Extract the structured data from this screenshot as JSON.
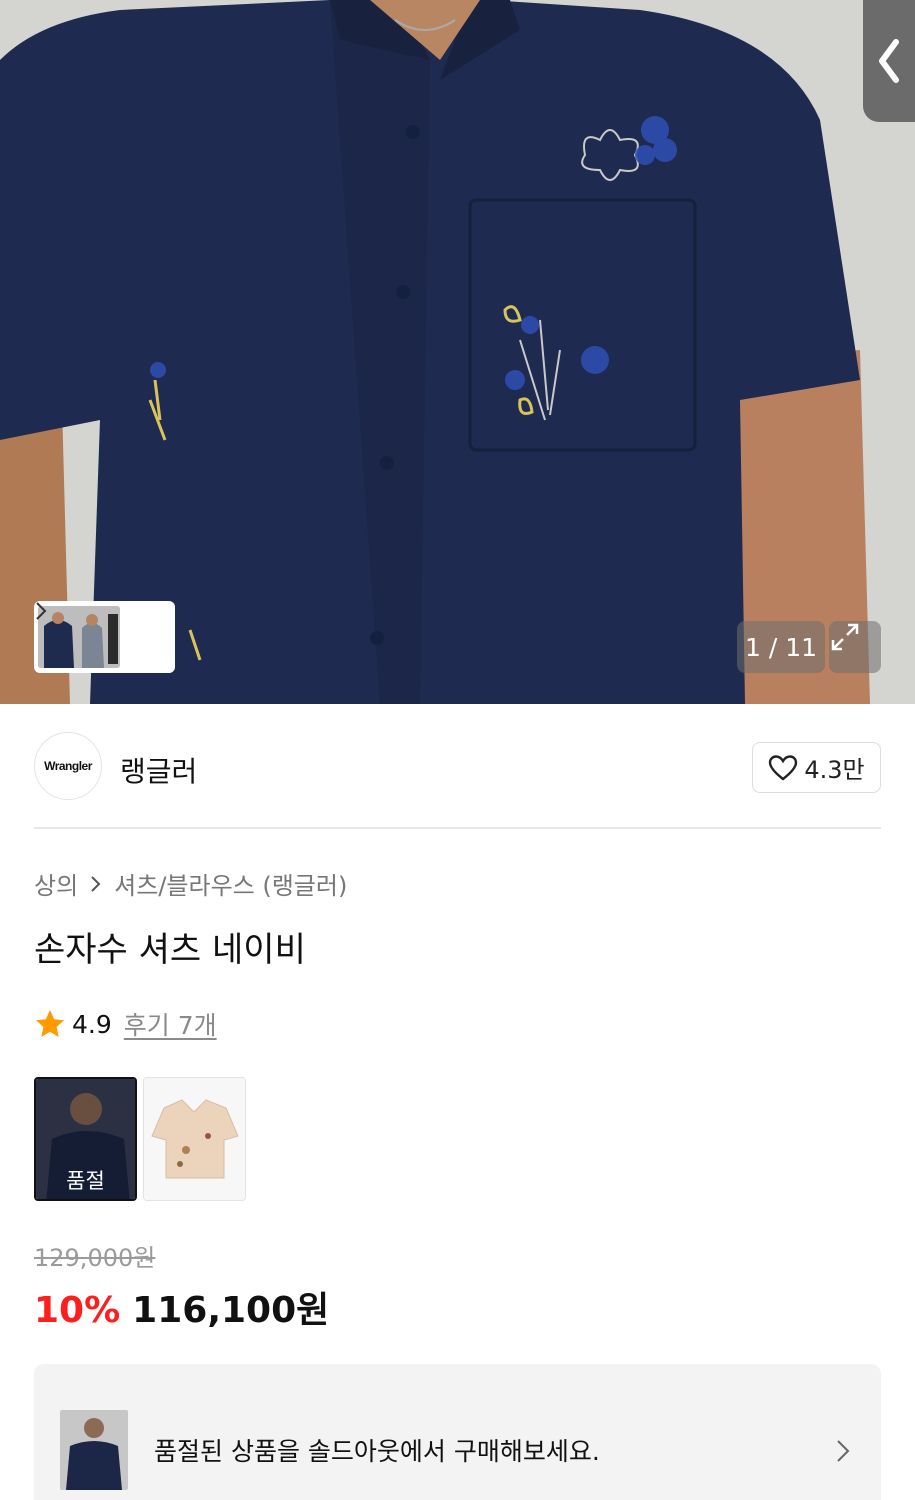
{
  "gallery": {
    "counter": "1 / 11"
  },
  "brand": {
    "logo_text": "Wrangler",
    "name": "랭글러",
    "like_count": "4.3만"
  },
  "breadcrumb": {
    "category": "상의",
    "subcategory": "셔츠/블라우스 (랭글러)"
  },
  "product": {
    "title": "손자수 셔츠 네이비",
    "rating": "4.9",
    "reviews_label": "후기 7개",
    "rating_color": "#ff9b00"
  },
  "options": {
    "selected_badge": "품절"
  },
  "price": {
    "original": "129,000원",
    "discount": "10%",
    "sale": "116,100원",
    "discount_color": "#ff1e1e"
  },
  "soldout_banner": {
    "text": "품절된 상품을 솔드아웃에서 구매해보세요."
  }
}
